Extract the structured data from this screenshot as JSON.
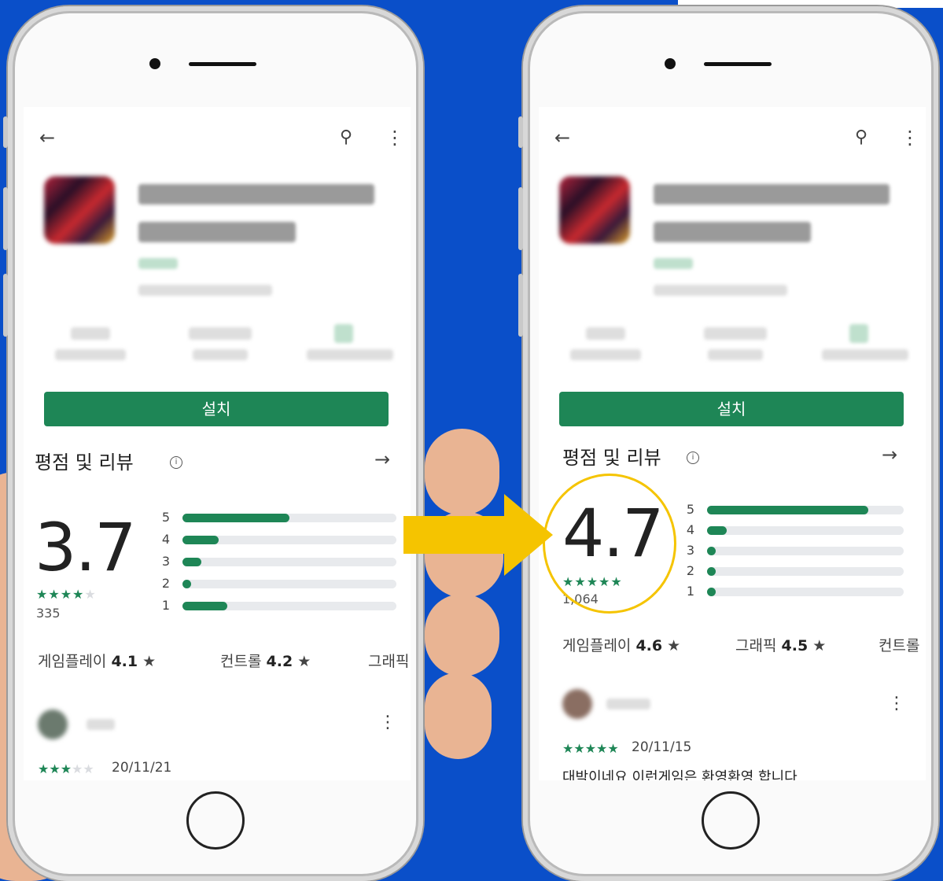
{
  "left_screen": {
    "install_label": "설치",
    "section_title": "평점 및 리뷰",
    "rating": "3.7",
    "stars": "★★★★★",
    "review_count": "335",
    "bars": [
      {
        "label": "5",
        "fill": 0.5
      },
      {
        "label": "4",
        "fill": 0.17
      },
      {
        "label": "3",
        "fill": 0.09
      },
      {
        "label": "2",
        "fill": 0.03
      },
      {
        "label": "1",
        "fill": 0.21
      }
    ],
    "categories": [
      {
        "name": "게임플레이",
        "score": "4.1"
      },
      {
        "name": "컨트롤",
        "score": "4.2"
      },
      {
        "name": "그래픽",
        "score": ""
      }
    ],
    "review_stars": "★★★★★",
    "review_date": "20/11/21"
  },
  "right_screen": {
    "install_label": "설치",
    "section_title": "평점 및 리뷰",
    "rating": "4.7",
    "stars": "★★★★★",
    "review_count": "1,064",
    "bars": [
      {
        "label": "5",
        "fill": 0.82
      },
      {
        "label": "4",
        "fill": 0.1
      },
      {
        "label": "3",
        "fill": 0.03
      },
      {
        "label": "2",
        "fill": 0.03
      },
      {
        "label": "1",
        "fill": 0.03
      }
    ],
    "categories": [
      {
        "name": "게임플레이",
        "score": "4.6"
      },
      {
        "name": "그래픽",
        "score": "4.5"
      },
      {
        "name": "컨트롤",
        "score": ""
      }
    ],
    "review_stars": "★★★★★",
    "review_date": "20/11/15",
    "review_text": "대박이네요 이런게임은 환영환영 합니다"
  },
  "colors": {
    "background": "#0a4fc9",
    "accent_green": "#1e8656",
    "highlight_yellow": "#f5c400"
  },
  "icons": {
    "back": "arrow-left-icon",
    "search": "search-icon",
    "more": "more-vertical-icon",
    "info": "info-icon",
    "forward": "arrow-right-icon"
  }
}
